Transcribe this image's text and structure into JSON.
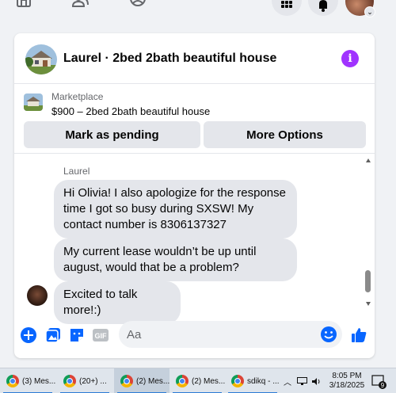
{
  "colors": {
    "accent": "#0866ff",
    "info": "#a033ff",
    "bubble": "#e4e6eb",
    "background": "#f0f2f5"
  },
  "topnav": {
    "icons": [
      "home-icon",
      "friends-icon",
      "groups-icon",
      "menu-grid-icon",
      "notifications-bell-icon",
      "profile-avatar"
    ]
  },
  "header": {
    "title": "Laurel · 2bed 2bath beautiful house",
    "info_icon": "info-icon"
  },
  "listing": {
    "source": "Marketplace",
    "price_title": "$900 – 2bed 2bath beautiful house",
    "mark_pending_label": "Mark as pending",
    "more_options_label": "More Options"
  },
  "messages": {
    "sender": "Laurel",
    "items": [
      {
        "text": "Hi Olivia! I also apologize for the response time I got so busy during SXSW! My contact number is 8306137327"
      },
      {
        "text": "My current lease wouldn’t be up until august, would that be a problem?"
      },
      {
        "text": "Excited to talk more!:)"
      }
    ]
  },
  "composer": {
    "placeholder": "Aa",
    "icons": [
      "add-icon",
      "photo-icon",
      "sticker-icon",
      "gif-icon",
      "emoji-icon",
      "like-icon"
    ],
    "gif_label": "GIF"
  },
  "taskbar": {
    "items": [
      {
        "label": "(3) Mes..."
      },
      {
        "label": "(20+) ..."
      },
      {
        "label": "(2) Mes..."
      },
      {
        "label": "(2) Mes..."
      },
      {
        "label": "sdikq - ..."
      }
    ],
    "time": "8:05 PM",
    "date": "3/18/2025",
    "notifications": "9"
  }
}
